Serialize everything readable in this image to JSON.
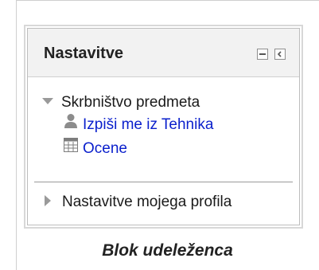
{
  "block": {
    "title": "Nastavitve",
    "controls": {
      "hide_icon": "minus-box-icon",
      "dock_icon": "dock-left-icon"
    },
    "tree": {
      "course_node": "Skrbništvo predmeta",
      "course_children": [
        {
          "label": "Izpiši me iz Tehnika",
          "icon": "user-icon"
        },
        {
          "label": "Ocene",
          "icon": "grades-table-icon"
        }
      ],
      "profile_node": "Nastavitve mojega profila"
    }
  },
  "caption": "Blok udeleženca",
  "colors": {
    "link": "#0a1fcc",
    "header_bg": "#f2f2f2",
    "border": "#d8d8d8"
  }
}
